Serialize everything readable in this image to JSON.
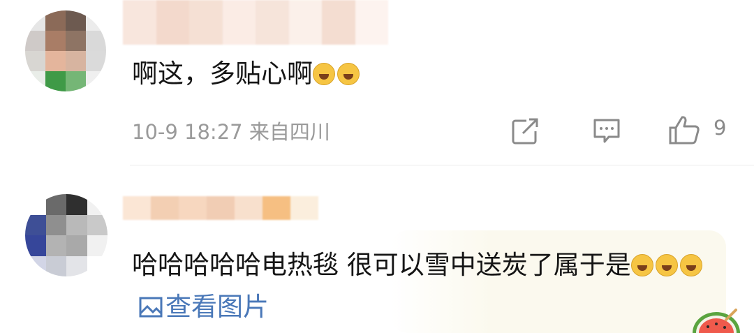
{
  "comments": [
    {
      "text": "啊这，多贴心啊",
      "emojis": [
        "laughing-crying",
        "laughing-crying"
      ],
      "meta": "10-9 18:27  来自四川",
      "like_count": "9"
    },
    {
      "text": "哈哈哈哈哈电热毯 很可以雪中送炭了属于是",
      "emojis": [
        "laughing-crying",
        "laughing-crying",
        "laughing-crying"
      ],
      "view_image": "查看图片"
    }
  ],
  "colors": {
    "link": "#4a78b8",
    "meta": "#9a9a9a"
  }
}
